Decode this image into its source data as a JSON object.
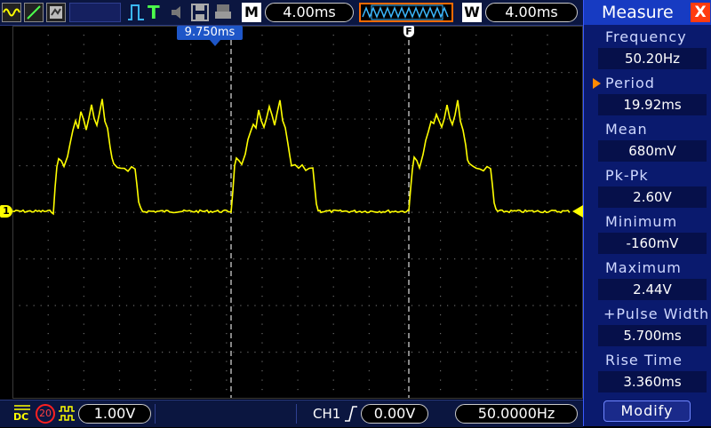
{
  "topbar": {
    "mode_m": "M",
    "timebase": "4.00ms",
    "mode_w": "W",
    "window_timebase": "4.00ms",
    "run_status": "T"
  },
  "screen": {
    "trigger_offset": "9.750ms",
    "f_marker": "F",
    "ch1_marker": "1",
    "trace_color": "#ffff00"
  },
  "measure": {
    "title": "Measure",
    "close": "X",
    "items": [
      {
        "label": "Frequency",
        "value": "50.20Hz"
      },
      {
        "label": "Period",
        "value": "19.92ms"
      },
      {
        "label": "Mean",
        "value": "680mV"
      },
      {
        "label": "Pk-Pk",
        "value": "2.60V"
      },
      {
        "label": "Minimum",
        "value": "-160mV"
      },
      {
        "label": "Maximum",
        "value": "2.44V"
      },
      {
        "label": "+Pulse Width",
        "value": "5.700ms"
      },
      {
        "label": "Rise Time",
        "value": "3.360ms"
      }
    ],
    "modify_label": "Modify"
  },
  "bottombar": {
    "coupling": "DC",
    "bw_limit": "20",
    "volts_div": "1.00V",
    "trigger_source": "CH1",
    "trigger_level": "0.00V",
    "trigger_freq": "50.0000Hz"
  }
}
